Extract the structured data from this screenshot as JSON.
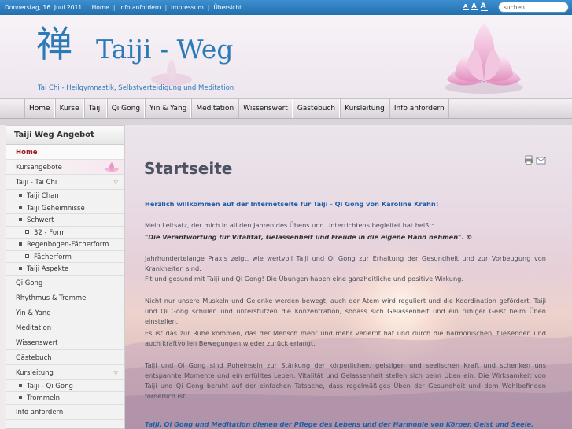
{
  "topbar": {
    "date": "Donnerstag, 16. Juni 2011",
    "links": [
      "Home",
      "Info anfordern",
      "Impressum",
      "Übersicht"
    ],
    "font_sizes": [
      "A",
      "A",
      "A"
    ],
    "search_placeholder": "suchen..."
  },
  "header": {
    "logo_char": "禅",
    "site_name": "Taiji - Weg",
    "tagline": "Tai Chi - Heilgymnastik, Selbstverteidigung und Meditation"
  },
  "nav": [
    "Home",
    "Kurse",
    "Taiji",
    "Qi Gong",
    "Yin & Yang",
    "Meditation",
    "Wissenswert",
    "Gästebuch",
    "Kursleitung",
    "Info anfordern"
  ],
  "sidebar": {
    "title": "Taiji Weg Angebot",
    "items": [
      {
        "label": "Home",
        "level": 1,
        "active": true
      },
      {
        "label": "Kursangebote",
        "level": 1,
        "highlight": true
      },
      {
        "label": "Taiji - Tai Chi",
        "level": 1,
        "expanded": true
      },
      {
        "label": "Taiji Chan",
        "level": 2
      },
      {
        "label": "Taiji Geheimnisse",
        "level": 2
      },
      {
        "label": "Schwert",
        "level": 2
      },
      {
        "label": "32 - Form",
        "level": 3
      },
      {
        "label": "Regenbogen-Fächerform",
        "level": 2
      },
      {
        "label": "Fächerform",
        "level": 3
      },
      {
        "label": "Taiji Aspekte",
        "level": 2
      },
      {
        "label": "Qi Gong",
        "level": 1
      },
      {
        "label": "Rhythmus & Trommel",
        "level": 1
      },
      {
        "label": "Yin & Yang",
        "level": 1
      },
      {
        "label": "Meditation",
        "level": 1
      },
      {
        "label": "Wissenswert",
        "level": 1
      },
      {
        "label": "Gästebuch",
        "level": 1
      },
      {
        "label": "Kursleitung",
        "level": 1,
        "expanded": true
      },
      {
        "label": "Taiji - Qi Gong",
        "level": 2
      },
      {
        "label": "Trommeln",
        "level": 2
      },
      {
        "label": "Info anfordern",
        "level": 1
      }
    ]
  },
  "content": {
    "title": "Startseite",
    "welcome": "Herzlich willkommen auf der Internetseite für Taiji - Qi Gong von Karoline Krahn!",
    "intro": "Mein Leitsatz, der mich in all den Jahren des Übens und Unterrichtens begleitet hat heißt:",
    "motto": "\"Die Verantwortung für Vitalität, Gelassenheit und Freude in die eigene Hand nehmen\". ©",
    "p1": "Jahrhundertelange Praxis zeigt, wie wertvoll Taiji und Qi Gong zur Erhaltung der Gesundheit und zur Vorbeugung von Krankheiten sind.",
    "p1b": "Fit und gesund mit Taiji und Qi Gong! Die Übungen haben eine ganzheitliche und positive Wirkung.",
    "p2": "Nicht nur unsere Muskeln und Gelenke werden bewegt, auch der Atem wird reguliert und die Koordination gefördert. Taiji und Qi Gong schulen und unterstützen die Konzentration, sodass sich Gelassenheit und ein ruhiger Geist beim Üben einstellen.",
    "p2b": "Es ist das zur Ruhe kommen, das der Mensch mehr und mehr verlernt hat und durch die harmonischen, fließenden und auch kraftvollen Bewegungen wieder zurück erlangt.",
    "p3": "Taiji und Qi Gong sind Ruheinseln zur Stärkung der körperlichen, geistigen und seelischen Kraft und schenken uns entspannte Momente und ein erfülltes Leben. Vitalität und Gelassenheit stellen sich beim Üben ein. Die Wirksamkeit von Taiji und Qi Gong beruht auf der einfachen Tatsache, dass regelmäßiges Üben der Gesundheit und dem Wohlbefinden förderlich ist.",
    "bottom": "Taiji, Qi Gong und Meditation dienen der Pflege des Lebens und der Harmonie von Körper, Geist und Seele."
  },
  "colors": {
    "topbar": "#2a78b8",
    "brand_blue": "#2d7ab9",
    "active_red": "#9b1b2c",
    "lotus_pink": "#e79ac4"
  },
  "icons": [
    "print-icon",
    "email-icon",
    "lotus-icon",
    "chevron-down-icon"
  ]
}
